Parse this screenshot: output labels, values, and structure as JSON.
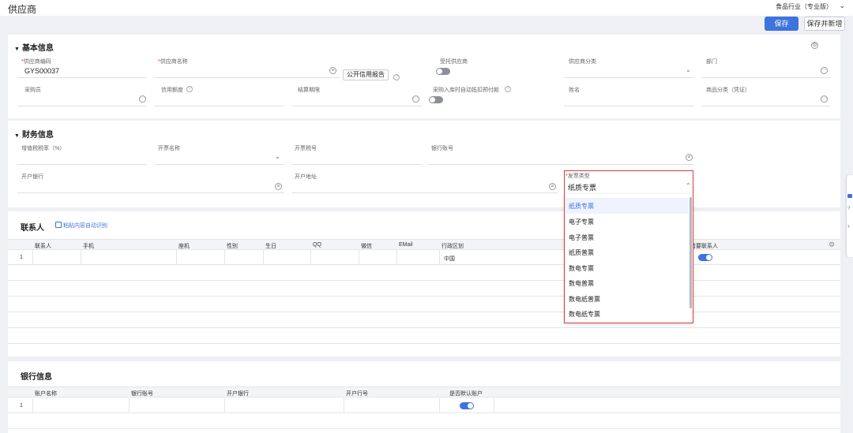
{
  "header": {
    "page_title": "供应商",
    "industry_selector": "食品行业（专业版）",
    "save_button": "保存",
    "save_and_new_button": "保存并新增"
  },
  "basic_info": {
    "title": "基本信息",
    "fields": {
      "supplier_code": {
        "label": "供应商编码",
        "value": "GYS00037"
      },
      "supplier_name": {
        "label": "供应商名称",
        "value": ""
      },
      "credit_report_button": "公开信用报告",
      "consigned_supplier": {
        "label": "受托供应商",
        "on": false
      },
      "supplier_category": {
        "label": "供应商分类"
      },
      "department": {
        "label": "部门"
      },
      "purchaser": {
        "label": "采购员"
      },
      "credit_limit": {
        "label": "信用额度"
      },
      "settlement_period": {
        "label": "结算期限"
      },
      "auto_offset_prepayment": {
        "label": "采购入库时自动抵扣预付款",
        "on": false
      },
      "name": {
        "label": "姓名"
      },
      "goods_category": {
        "label": "商品分类（凭证）"
      }
    }
  },
  "finance_info": {
    "title": "财务信息",
    "fields": {
      "vat_rate": {
        "label": "增值税税率（%）"
      },
      "invoice_name": {
        "label": "开票名称"
      },
      "tax_number": {
        "label": "开票税号"
      },
      "bank_account": {
        "label": "银行账号"
      },
      "bank_name": {
        "label": "开户银行"
      },
      "address": {
        "label": "开户地址"
      },
      "invoice_type": {
        "label": "发票类型",
        "value": "纸质专票"
      }
    }
  },
  "invoice_type_dropdown": {
    "options": [
      "纸质专票",
      "电子专票",
      "电子普票",
      "纸质普票",
      "数电专票",
      "数电普票",
      "数电纸普票",
      "数电纸专票"
    ],
    "selected_index": 0
  },
  "contacts": {
    "title": "联系人",
    "paste_link": "粘贴内容自动识别",
    "columns": [
      "联系人",
      "手机",
      "座机",
      "性别",
      "生日",
      "QQ",
      "微信",
      "EMail",
      "行政区划",
      "首要联系人"
    ],
    "rows": [
      {
        "index": "1",
        "region": "中国",
        "primary": true
      }
    ]
  },
  "bank_info": {
    "title": "银行信息",
    "columns": [
      "账户名称",
      "银行账号",
      "开户银行",
      "开户行号",
      "是否默认账户"
    ],
    "rows": [
      {
        "index": "1",
        "default": true
      }
    ]
  }
}
